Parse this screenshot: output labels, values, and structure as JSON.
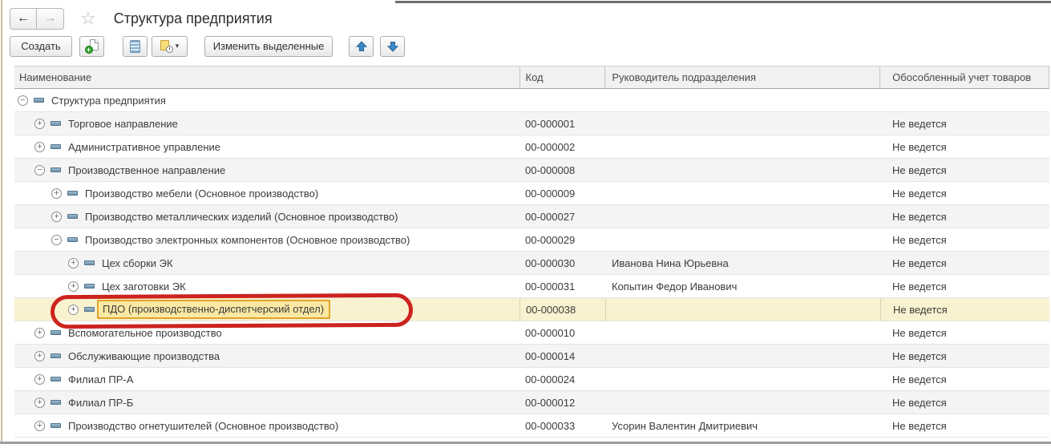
{
  "header": {
    "title": "Структура предприятия"
  },
  "icons": {
    "back": "←",
    "forward": "→",
    "star": "☆",
    "dropdown_caret": "▾",
    "expander_collapsed": "+",
    "expander_expanded": "−"
  },
  "toolbar": {
    "create_label": "Создать",
    "edit_selected_label": "Изменить выделенные"
  },
  "table": {
    "columns": [
      "Наименование",
      "Код",
      "Руководитель подразделения",
      "Обособленный учет товаров"
    ],
    "rows": [
      {
        "name": "Структура предприятия",
        "level": 0,
        "state": "expanded",
        "code": "",
        "manager": "",
        "accounting": "",
        "highlighted": false
      },
      {
        "name": "Торговое направление",
        "level": 1,
        "state": "collapsed",
        "code": "00-000001",
        "manager": "",
        "accounting": "Не ведется",
        "highlighted": false
      },
      {
        "name": "Административное управление",
        "level": 1,
        "state": "collapsed",
        "code": "00-000002",
        "manager": "",
        "accounting": "Не ведется",
        "highlighted": false
      },
      {
        "name": "Производственное направление",
        "level": 1,
        "state": "expanded",
        "code": "00-000008",
        "manager": "",
        "accounting": "Не ведется",
        "highlighted": false
      },
      {
        "name": "Производство мебели (Основное производство)",
        "level": 2,
        "state": "collapsed",
        "code": "00-000009",
        "manager": "",
        "accounting": "Не ведется",
        "highlighted": false
      },
      {
        "name": "Производство металлических изделий (Основное производство)",
        "level": 2,
        "state": "collapsed",
        "code": "00-000027",
        "manager": "",
        "accounting": "Не ведется",
        "highlighted": false
      },
      {
        "name": "Производство электронных компонентов (Основное производство)",
        "level": 2,
        "state": "expanded",
        "code": "00-000029",
        "manager": "",
        "accounting": "Не ведется",
        "highlighted": false
      },
      {
        "name": "Цех сборки ЭК",
        "level": 3,
        "state": "collapsed",
        "code": "00-000030",
        "manager": "Иванова Нина Юрьевна",
        "accounting": "Не ведется",
        "highlighted": false
      },
      {
        "name": "Цех заготовки ЭК",
        "level": 3,
        "state": "collapsed",
        "code": "00-000031",
        "manager": "Копытин Федор Иванович",
        "accounting": "Не ведется",
        "highlighted": false
      },
      {
        "name": "ПДО (производственно-диспетчерский отдел)",
        "level": 3,
        "state": "collapsed",
        "code": "00-000038",
        "manager": "",
        "accounting": "Не ведется",
        "highlighted": true
      },
      {
        "name": "Вспомогательное производство",
        "level": 1,
        "state": "collapsed",
        "code": "00-000010",
        "manager": "",
        "accounting": "Не ведется",
        "highlighted": false
      },
      {
        "name": "Обслуживающие производства",
        "level": 1,
        "state": "collapsed",
        "code": "00-000014",
        "manager": "",
        "accounting": "Не ведется",
        "highlighted": false
      },
      {
        "name": "Филиал ПР-А",
        "level": 1,
        "state": "collapsed",
        "code": "00-000024",
        "manager": "",
        "accounting": "Не ведется",
        "highlighted": false
      },
      {
        "name": "Филиал ПР-Б",
        "level": 1,
        "state": "collapsed",
        "code": "00-000012",
        "manager": "",
        "accounting": "Не ведется",
        "highlighted": false
      },
      {
        "name": "Производство огнетушителей (Основное производство)",
        "level": 1,
        "state": "collapsed",
        "code": "00-000033",
        "manager": "Усорин Валентин Дмитриевич",
        "accounting": "Не ведется",
        "highlighted": false
      }
    ]
  },
  "colors": {
    "highlight_row": "#f9f2d0",
    "focus_cell_bg": "#fbe8a3",
    "focus_cell_border": "#dfa42c",
    "annotation_red": "#cc231e",
    "tree_group_icon": "#6e94ac",
    "toolbar_arrow_blue": "#3d89c4"
  }
}
